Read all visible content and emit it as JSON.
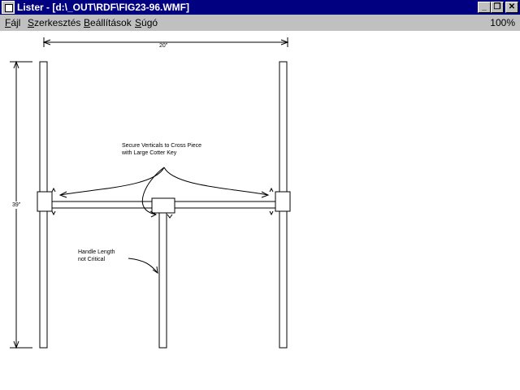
{
  "window": {
    "title": "Lister - [d:\\_OUT\\RDF\\FIG23-96.WMF]",
    "min_button": "_",
    "restore_button": "❐",
    "close_button": "✕"
  },
  "menu": {
    "items": [
      {
        "label_first": "F",
        "label_rest": "ájl"
      },
      {
        "label_first": "S",
        "label_rest": "zerkesztés"
      },
      {
        "label_first": "B",
        "label_rest": "eállítások"
      },
      {
        "label_first": "S",
        "label_rest": "úgó"
      }
    ],
    "zoom": "100%"
  },
  "drawing": {
    "width_dim": "20\"",
    "height_dim": "39\"",
    "note_secure": "Secure Verticals to Cross Piece\nwith Large Cotter Key",
    "note_handle": "Handle Length\nnot Critical"
  },
  "colors": {
    "titlebar": "#000080",
    "chrome": "#c0c0c0"
  }
}
